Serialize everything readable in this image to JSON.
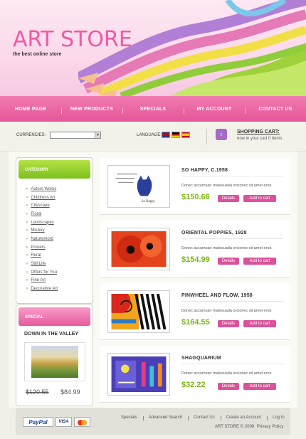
{
  "header": {
    "logo": "ART STORE",
    "tagline": "the best online store"
  },
  "nav": {
    "items": [
      "HOME PAGE",
      "NEW PRODUCTS",
      "SPECIALS",
      "MY ACCOUNT",
      "CONTACT US"
    ]
  },
  "bar": {
    "currencies_label": "CURRENCIES:",
    "currency_value": "",
    "language_label": "LANGUAGE:",
    "cart_title": "SHOPPING CART:",
    "cart_text": "now in your cart 0 items"
  },
  "category": {
    "title": "CATEGORY",
    "items": [
      "Autors Works",
      "Childrens Art",
      "Cityscape",
      "Floral",
      "Landscapes",
      "Mistery",
      "Naturemord",
      "Posters",
      "Rural",
      "Still Life",
      "Offers for You",
      "Fine Art",
      "Decorative Art"
    ]
  },
  "special": {
    "title": "SPECIAL",
    "product_name": "DOWN IN THE VALLEY",
    "old_price": "$120.55",
    "new_price": "$84.99"
  },
  "products": [
    {
      "name": "SO HAPPY, C.1958",
      "desc": "Donec accumsan malesuada orcionec sit amet eros.",
      "price": "$150.66"
    },
    {
      "name": "ORIENTAL POPPIES, 1928",
      "desc": "Donec accumsan malesuada orcionec sit amet eros.",
      "price": "$154.99"
    },
    {
      "name": "PINWHEEL AND FLOW, 1958",
      "desc": "Donec accumsan malesuada orcionec sit amet eros.",
      "price": "$164.55"
    },
    {
      "name": "SHAGQUARIUM",
      "desc": "Donec accumsan malesuada orcionec sit amet eros.",
      "price": "$32.22"
    }
  ],
  "buttons": {
    "details": "Details",
    "add_to_cart": "Add to cart"
  },
  "footer": {
    "links": [
      "Specials",
      "Advanced Search",
      "Contact Us",
      "Create an Account",
      "Log In"
    ],
    "copyright": "ART STORE © 2008",
    "privacy": "Privacy Policy",
    "paypal": "PayPal",
    "visa": "VISA"
  }
}
